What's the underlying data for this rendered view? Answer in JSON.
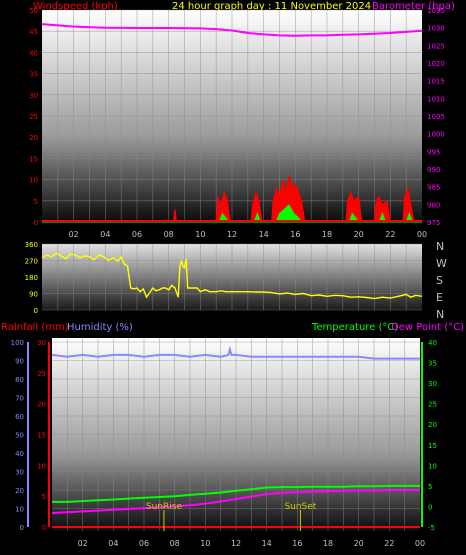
{
  "title": "24 hour graph day : 11 November 2024",
  "x_ticks": [
    "02",
    "04",
    "06",
    "08",
    "10",
    "12",
    "14",
    "16",
    "18",
    "20",
    "22",
    "00"
  ],
  "colors": {
    "wind": "#ff0000",
    "gust": "#00ff00",
    "baro": "#ff00ff",
    "title": "#ffff00",
    "dir": "#ffff00",
    "rain": "#ff0000",
    "humidity": "#8888ff",
    "temperature": "#00ff00",
    "dewpoint": "#ff00ff",
    "sun": "#cccc00",
    "axis_labels": "#c0c0c0"
  },
  "chart_data": [
    {
      "type": "area",
      "panel": "wind-barometer",
      "ylabel_left": "Windspeed (kph)",
      "ylabel_right": "Barometer (hpa)",
      "left_ticks": [
        0,
        5,
        10,
        15,
        20,
        25,
        30,
        35,
        40,
        45,
        50
      ],
      "right_ticks": [
        975,
        980,
        985,
        990,
        995,
        1000,
        1005,
        1010,
        1015,
        1020,
        1025,
        1030,
        1035
      ],
      "ylim_left": [
        0,
        50
      ],
      "ylim_right": [
        975,
        1035
      ],
      "x_hours": [
        0,
        24
      ],
      "series": [
        {
          "name": "Barometer (hpa)",
          "axis": "right",
          "points": [
            [
              0,
              1031
            ],
            [
              2,
              1030.3
            ],
            [
              4,
              1030
            ],
            [
              6,
              1029.9
            ],
            [
              8,
              1029.9
            ],
            [
              10,
              1029.8
            ],
            [
              11,
              1029.6
            ],
            [
              12,
              1029.2
            ],
            [
              13,
              1028.5
            ],
            [
              14,
              1028.1
            ],
            [
              15,
              1027.8
            ],
            [
              16,
              1027.7
            ],
            [
              17,
              1027.8
            ],
            [
              18,
              1027.8
            ],
            [
              19,
              1028
            ],
            [
              20,
              1028.1
            ],
            [
              21,
              1028.3
            ],
            [
              22,
              1028.5
            ],
            [
              23,
              1028.8
            ],
            [
              24,
              1029.1
            ]
          ]
        },
        {
          "name": "Windspeed (kph)",
          "axis": "left",
          "points": [
            [
              0,
              0
            ],
            [
              8.3,
              0
            ],
            [
              8.4,
              3
            ],
            [
              8.5,
              0
            ],
            [
              11,
              0
            ],
            [
              11.1,
              6
            ],
            [
              11.3,
              4
            ],
            [
              11.5,
              7
            ],
            [
              11.7,
              5
            ],
            [
              11.9,
              0
            ],
            [
              13.2,
              0
            ],
            [
              13.3,
              4
            ],
            [
              13.5,
              7
            ],
            [
              13.7,
              5
            ],
            [
              13.9,
              0
            ],
            [
              14.5,
              0
            ],
            [
              14.6,
              5
            ],
            [
              14.8,
              8
            ],
            [
              15,
              6
            ],
            [
              15.2,
              10
            ],
            [
              15.4,
              7
            ],
            [
              15.6,
              11
            ],
            [
              15.8,
              8
            ],
            [
              16,
              9
            ],
            [
              16.2,
              7
            ],
            [
              16.4,
              5
            ],
            [
              16.6,
              0
            ],
            [
              19.2,
              0
            ],
            [
              19.3,
              5
            ],
            [
              19.5,
              7
            ],
            [
              19.7,
              5
            ],
            [
              20,
              6
            ],
            [
              20.2,
              0
            ],
            [
              21,
              0
            ],
            [
              21.1,
              5
            ],
            [
              21.3,
              6
            ],
            [
              21.5,
              4
            ],
            [
              21.8,
              5
            ],
            [
              22,
              0
            ],
            [
              22.8,
              0
            ],
            [
              22.9,
              6
            ],
            [
              23.1,
              8
            ],
            [
              23.3,
              4
            ],
            [
              23.5,
              0
            ],
            [
              24,
              0
            ]
          ]
        },
        {
          "name": "Gust (kph)",
          "axis": "left",
          "points": [
            [
              0,
              0
            ],
            [
              11.2,
              0
            ],
            [
              11.4,
              2
            ],
            [
              11.6,
              1
            ],
            [
              11.8,
              0
            ],
            [
              13.4,
              0
            ],
            [
              13.6,
              2
            ],
            [
              13.8,
              0
            ],
            [
              14.8,
              0
            ],
            [
              15,
              2
            ],
            [
              15.3,
              3
            ],
            [
              15.6,
              4
            ],
            [
              15.9,
              2
            ],
            [
              16.2,
              1
            ],
            [
              16.4,
              0
            ],
            [
              19.4,
              0
            ],
            [
              19.6,
              2
            ],
            [
              19.8,
              1
            ],
            [
              20,
              0
            ],
            [
              21.3,
              0
            ],
            [
              21.5,
              2
            ],
            [
              21.7,
              0
            ],
            [
              23,
              0
            ],
            [
              23.2,
              2
            ],
            [
              23.4,
              0
            ],
            [
              24,
              0
            ]
          ]
        }
      ]
    },
    {
      "type": "line",
      "panel": "wind-direction",
      "left_ticks": [
        0,
        90,
        180,
        270,
        360
      ],
      "compass_labels": [
        "N",
        "W",
        "S",
        "E",
        "N"
      ],
      "ylim": [
        0,
        360
      ],
      "x_hours": [
        0,
        24
      ],
      "series": [
        {
          "name": "Wind Direction",
          "points": [
            [
              0,
              285
            ],
            [
              0.3,
              300
            ],
            [
              0.6,
              290
            ],
            [
              0.9,
              310
            ],
            [
              1.2,
              295
            ],
            [
              1.5,
              280
            ],
            [
              1.8,
              305
            ],
            [
              2.1,
              300
            ],
            [
              2.4,
              285
            ],
            [
              2.7,
              295
            ],
            [
              3,
              290
            ],
            [
              3.3,
              275
            ],
            [
              3.6,
              300
            ],
            [
              3.9,
              290
            ],
            [
              4.2,
              270
            ],
            [
              4.5,
              285
            ],
            [
              4.8,
              265
            ],
            [
              5,
              290
            ],
            [
              5.2,
              250
            ],
            [
              5.4,
              240
            ],
            [
              5.6,
              120
            ],
            [
              5.8,
              115
            ],
            [
              6,
              120
            ],
            [
              6.2,
              100
            ],
            [
              6.4,
              115
            ],
            [
              6.6,
              70
            ],
            [
              6.8,
              95
            ],
            [
              7,
              120
            ],
            [
              7.2,
              105
            ],
            [
              7.4,
              110
            ],
            [
              7.6,
              120
            ],
            [
              7.8,
              120
            ],
            [
              8,
              110
            ],
            [
              8.2,
              135
            ],
            [
              8.4,
              120
            ],
            [
              8.6,
              70
            ],
            [
              8.7,
              230
            ],
            [
              8.8,
              270
            ],
            [
              8.9,
              240
            ],
            [
              9,
              230
            ],
            [
              9.1,
              280
            ],
            [
              9.2,
              120
            ],
            [
              9.5,
              120
            ],
            [
              9.8,
              120
            ],
            [
              10,
              100
            ],
            [
              10.3,
              110
            ],
            [
              10.6,
              100
            ],
            [
              11,
              100
            ],
            [
              11.3,
              105
            ],
            [
              11.6,
              100
            ],
            [
              12,
              100
            ],
            [
              12.5,
              100
            ],
            [
              13,
              100
            ],
            [
              13.5,
              98
            ],
            [
              14,
              98
            ],
            [
              14.5,
              95
            ],
            [
              15,
              88
            ],
            [
              15.5,
              92
            ],
            [
              16,
              85
            ],
            [
              16.5,
              90
            ],
            [
              17,
              78
            ],
            [
              17.5,
              82
            ],
            [
              18,
              75
            ],
            [
              18.5,
              80
            ],
            [
              19,
              78
            ],
            [
              19.5,
              70
            ],
            [
              20,
              72
            ],
            [
              20.5,
              68
            ],
            [
              21,
              62
            ],
            [
              21.5,
              70
            ],
            [
              22,
              65
            ],
            [
              22.5,
              75
            ],
            [
              23,
              85
            ],
            [
              23.3,
              70
            ],
            [
              23.6,
              80
            ],
            [
              24,
              75
            ]
          ]
        }
      ]
    },
    {
      "type": "line",
      "panel": "rain-humidity-temperature",
      "ylabel_left_1": "Rainfall (mm)",
      "ylabel_left_2": "Humidity (%)",
      "ylabel_right_1": "Temperature (°C)",
      "ylabel_right_2": "Dew Point (°C)",
      "humidity_ticks": [
        0,
        10,
        20,
        30,
        40,
        50,
        60,
        70,
        80,
        90,
        100
      ],
      "rain_ticks": [
        0,
        5,
        10,
        15,
        20,
        25,
        30
      ],
      "temp_ticks": [
        -5,
        0,
        5,
        10,
        15,
        20,
        25,
        30,
        35,
        40
      ],
      "ylim_humidity": [
        0,
        100
      ],
      "ylim_rain": [
        0,
        30
      ],
      "ylim_temp": [
        -5,
        40
      ],
      "x_hours": [
        0,
        24
      ],
      "annotations": [
        {
          "label": "SunRise",
          "hour": 7.3
        },
        {
          "label": "SunSet",
          "hour": 16.2
        }
      ],
      "series": [
        {
          "name": "Humidity (%)",
          "axis": "humidity",
          "points": [
            [
              0,
              93
            ],
            [
              1,
              92
            ],
            [
              2,
              93
            ],
            [
              3,
              92
            ],
            [
              4,
              93
            ],
            [
              5,
              93
            ],
            [
              6,
              92
            ],
            [
              7,
              93
            ],
            [
              8,
              93
            ],
            [
              9,
              92
            ],
            [
              10,
              93
            ],
            [
              11,
              92
            ],
            [
              11.5,
              93
            ],
            [
              11.6,
              96
            ],
            [
              11.7,
              93
            ],
            [
              12,
              93
            ],
            [
              13,
              92
            ],
            [
              14,
              92
            ],
            [
              15,
              92
            ],
            [
              16,
              92
            ],
            [
              17,
              92
            ],
            [
              18,
              92
            ],
            [
              19,
              92
            ],
            [
              20,
              92
            ],
            [
              21,
              91
            ],
            [
              22,
              91
            ],
            [
              23,
              91
            ],
            [
              24,
              91
            ]
          ]
        },
        {
          "name": "Temperature (°C)",
          "axis": "temp",
          "points": [
            [
              0,
              1.1
            ],
            [
              1,
              1.1
            ],
            [
              2,
              1.3
            ],
            [
              3,
              1.5
            ],
            [
              4,
              1.7
            ],
            [
              5,
              1.9
            ],
            [
              6,
              2.1
            ],
            [
              7,
              2.3
            ],
            [
              8,
              2.5
            ],
            [
              9,
              2.8
            ],
            [
              10,
              3.1
            ],
            [
              11,
              3.4
            ],
            [
              12,
              3.8
            ],
            [
              13,
              4.2
            ],
            [
              14,
              4.6
            ],
            [
              15,
              4.7
            ],
            [
              16,
              4.7
            ],
            [
              17,
              4.8
            ],
            [
              18,
              4.8
            ],
            [
              19,
              4.8
            ],
            [
              20,
              4.9
            ],
            [
              21,
              4.9
            ],
            [
              22,
              5
            ],
            [
              23,
              5
            ],
            [
              24,
              5
            ]
          ]
        },
        {
          "name": "Dew Point (°C)",
          "axis": "temp",
          "points": [
            [
              0,
              -1.6
            ],
            [
              1,
              -1.4
            ],
            [
              2,
              -1.2
            ],
            [
              3,
              -1.0
            ],
            [
              4,
              -0.8
            ],
            [
              5,
              -0.6
            ],
            [
              6,
              -0.4
            ],
            [
              7,
              -0.2
            ],
            [
              8,
              0
            ],
            [
              9,
              0.3
            ],
            [
              10,
              0.7
            ],
            [
              11,
              1.2
            ],
            [
              12,
              1.8
            ],
            [
              13,
              2.4
            ],
            [
              14,
              3.0
            ],
            [
              15,
              3.3
            ],
            [
              16,
              3.5
            ],
            [
              17,
              3.6
            ],
            [
              18,
              3.7
            ],
            [
              19,
              3.8
            ],
            [
              20,
              3.9
            ],
            [
              21,
              3.9
            ],
            [
              22,
              4
            ],
            [
              23,
              4
            ],
            [
              24,
              4
            ]
          ]
        },
        {
          "name": "Rainfall (mm)",
          "axis": "rain",
          "points": [
            [
              0,
              0
            ],
            [
              24,
              0
            ]
          ]
        }
      ]
    }
  ]
}
